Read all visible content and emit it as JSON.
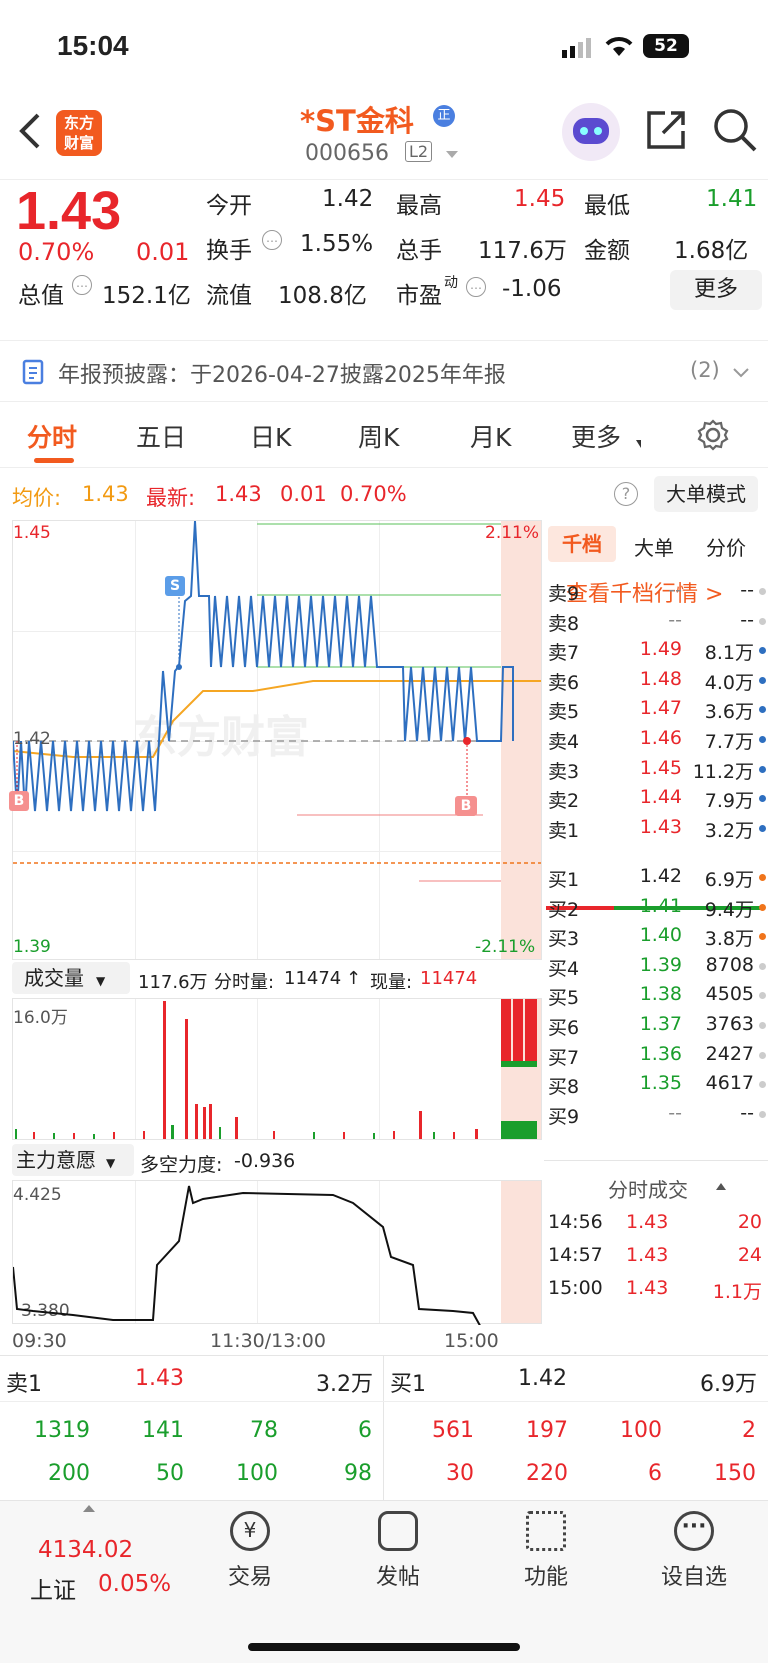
{
  "status_bar": {
    "time": "15:04",
    "battery": "52"
  },
  "nav": {
    "logo_line1": "东方",
    "logo_line2": "财富",
    "stock_name": "*ST金科",
    "badge": "正",
    "code": "000656",
    "level": "L2"
  },
  "quote": {
    "price": "1.43",
    "pct": "0.70%",
    "chg": "0.01",
    "open_label": "今开",
    "open": "1.42",
    "high_label": "最高",
    "high": "1.45",
    "low_label": "最低",
    "low": "1.41",
    "turnover_label": "换手",
    "turnover": "1.55%",
    "vol_label": "总手",
    "vol": "117.6万",
    "amount_label": "金额",
    "amount": "1.68亿",
    "mcap_label": "总值",
    "mcap": "152.1亿",
    "float_label": "流值",
    "float": "108.8亿",
    "pe_label": "市盈",
    "pe_sup": "动",
    "pe": "-1.06",
    "more": "更多"
  },
  "notice": {
    "text": "年报预披露：于2026-04-27披露2025年年报",
    "count": "(2)"
  },
  "tabs": [
    "分时",
    "五日",
    "日K",
    "周K",
    "月K",
    "更多"
  ],
  "infobar": {
    "avg_label": "均价:",
    "avg": "1.43",
    "latest_label": "最新:",
    "latest": "1.43",
    "chg": "0.01",
    "pct": "0.70%",
    "big_order": "大单模式"
  },
  "chart": {
    "y_top": "1.45",
    "y_mid": "1.42",
    "y_bot": "1.39",
    "pct_top": "2.11%",
    "pct_bot": "-2.11%",
    "marker_s": "S",
    "marker_b": "B",
    "watermark": "东方财富"
  },
  "volume": {
    "label": "成交量",
    "total": "117.6万",
    "detail_label": "分时量:",
    "detail": "11474",
    "arrow": "↑",
    "now_label": "现量:",
    "now": "11474",
    "scale": "16.0万"
  },
  "main_force": {
    "label": "主力意愿",
    "strength_label": "多空力度:",
    "strength": "-0.936",
    "top": "4.425",
    "bot": "3.380"
  },
  "time_axis": [
    "09:30",
    "11:30/13:00",
    "15:00"
  ],
  "orderbook": {
    "tabs": [
      "千档",
      "大单",
      "分价"
    ],
    "link": "查看千档行情 >",
    "asks": [
      {
        "label": "卖9",
        "price": "--",
        "vol": "--"
      },
      {
        "label": "卖8",
        "price": "--",
        "vol": "--"
      },
      {
        "label": "卖7",
        "price": "1.49",
        "vol": "8.1万"
      },
      {
        "label": "卖6",
        "price": "1.48",
        "vol": "4.0万"
      },
      {
        "label": "卖5",
        "price": "1.47",
        "vol": "3.6万"
      },
      {
        "label": "卖4",
        "price": "1.46",
        "vol": "7.7万"
      },
      {
        "label": "卖3",
        "price": "1.45",
        "vol": "11.2万"
      },
      {
        "label": "卖2",
        "price": "1.44",
        "vol": "7.9万"
      },
      {
        "label": "卖1",
        "price": "1.43",
        "vol": "3.2万"
      }
    ],
    "bids": [
      {
        "label": "买1",
        "price": "1.42",
        "vol": "6.9万"
      },
      {
        "label": "买2",
        "price": "1.41",
        "vol": "9.4万"
      },
      {
        "label": "买3",
        "price": "1.40",
        "vol": "3.8万"
      },
      {
        "label": "买4",
        "price": "1.39",
        "vol": "8708"
      },
      {
        "label": "买5",
        "price": "1.38",
        "vol": "4505"
      },
      {
        "label": "买6",
        "price": "1.37",
        "vol": "3763"
      },
      {
        "label": "买7",
        "price": "1.36",
        "vol": "2427"
      },
      {
        "label": "买8",
        "price": "1.35",
        "vol": "4617"
      },
      {
        "label": "买9",
        "price": "--",
        "vol": "--"
      }
    ],
    "ticks_title": "分时成交",
    "ticks": [
      {
        "time": "14:56",
        "price": "1.43",
        "vol": "20"
      },
      {
        "time": "14:57",
        "price": "1.43",
        "vol": "24"
      },
      {
        "time": "15:00",
        "price": "1.43",
        "vol": "1.1万"
      }
    ]
  },
  "bottom5": {
    "sell_label": "卖1",
    "sell_price": "1.43",
    "sell_vol": "3.2万",
    "buy_label": "买1",
    "buy_price": "1.42",
    "buy_vol": "6.9万",
    "sell_row1": [
      "1319",
      "141",
      "78",
      "6"
    ],
    "sell_row2": [
      "200",
      "50",
      "100",
      "98"
    ],
    "buy_row1": [
      "561",
      "197",
      "100",
      "2"
    ],
    "buy_row2": [
      "30",
      "220",
      "6",
      "150"
    ]
  },
  "tabbar": {
    "index_value": "4134.02",
    "index_name": "上证",
    "index_pct": "0.05%",
    "trade": "交易",
    "post": "发帖",
    "func": "功能",
    "watch": "设自选"
  }
}
